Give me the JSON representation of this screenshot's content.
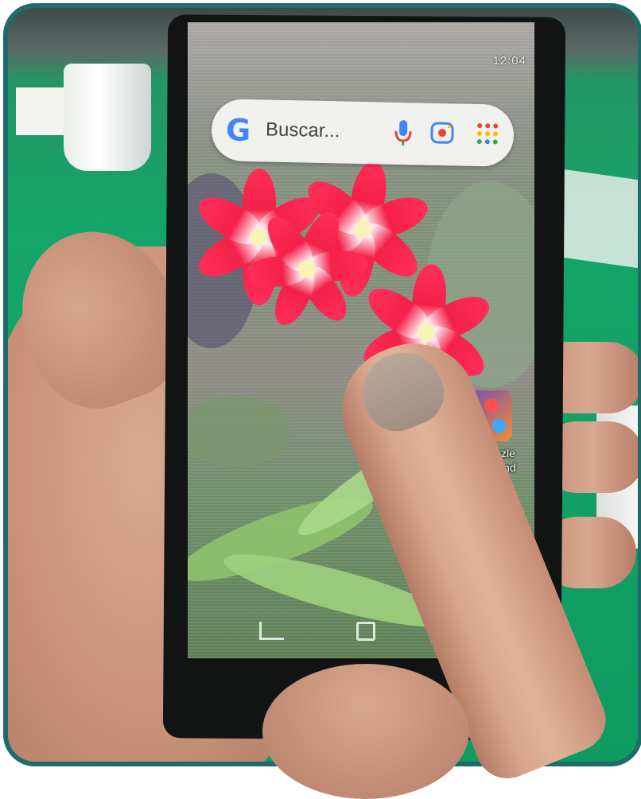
{
  "status_bar": {
    "time": "12:04"
  },
  "search_widget": {
    "google_glyph": "G",
    "placeholder": "Buscar..."
  },
  "home_apps": [
    {
      "label_line1": "Fruit Puzzle",
      "label_line2": "Wonderland",
      "icon": "fruit-puzzle-app-icon"
    }
  ],
  "colors": {
    "frame_border": "#1f6b68",
    "tablecloth": "#14a56a",
    "flower_red": "#f42149",
    "google_blue": "#4285f4"
  }
}
